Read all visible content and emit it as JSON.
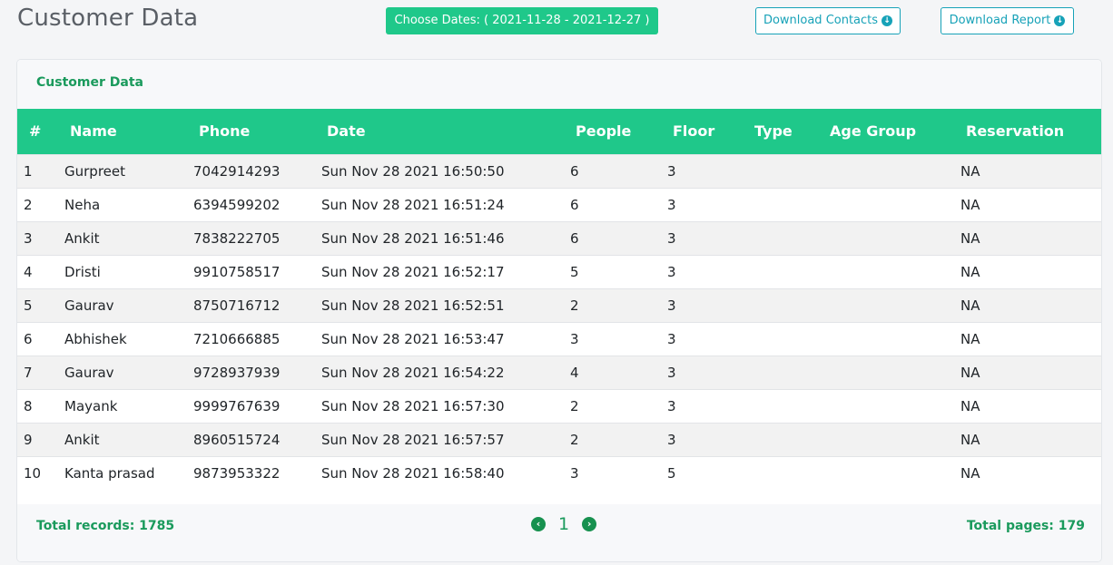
{
  "header": {
    "title": "Customer Data",
    "date_button": "Choose Dates: ( 2021-11-28 - 2021-12-27 )",
    "download_contacts": "Download Contacts",
    "download_report": "Download Report"
  },
  "card": {
    "title": "Customer Data",
    "columns": [
      "#",
      "Name",
      "Phone",
      "Date",
      "People",
      "Floor",
      "Type",
      "Age Group",
      "Reservation"
    ],
    "rows": [
      [
        "1",
        "Gurpreet",
        "7042914293",
        "Sun Nov 28 2021 16:50:50",
        "6",
        "3",
        "",
        "",
        "NA"
      ],
      [
        "2",
        "Neha",
        "6394599202",
        "Sun Nov 28 2021 16:51:24",
        "6",
        "3",
        "",
        "",
        "NA"
      ],
      [
        "3",
        "Ankit",
        "7838222705",
        "Sun Nov 28 2021 16:51:46",
        "6",
        "3",
        "",
        "",
        "NA"
      ],
      [
        "4",
        "Dristi",
        "9910758517",
        "Sun Nov 28 2021 16:52:17",
        "5",
        "3",
        "",
        "",
        "NA"
      ],
      [
        "5",
        "Gaurav",
        "8750716712",
        "Sun Nov 28 2021 16:52:51",
        "2",
        "3",
        "",
        "",
        "NA"
      ],
      [
        "6",
        "Abhishek",
        "7210666885",
        "Sun Nov 28 2021 16:53:47",
        "3",
        "3",
        "",
        "",
        "NA"
      ],
      [
        "7",
        "Gaurav",
        "9728937939",
        "Sun Nov 28 2021 16:54:22",
        "4",
        "3",
        "",
        "",
        "NA"
      ],
      [
        "8",
        "Mayank",
        "9999767639",
        "Sun Nov 28 2021 16:57:30",
        "2",
        "3",
        "",
        "",
        "NA"
      ],
      [
        "9",
        "Ankit",
        "8960515724",
        "Sun Nov 28 2021 16:57:57",
        "2",
        "3",
        "",
        "",
        "NA"
      ],
      [
        "10",
        "Kanta prasad",
        "9873953322",
        "Sun Nov 28 2021 16:58:40",
        "3",
        "5",
        "",
        "",
        "NA"
      ]
    ]
  },
  "footer": {
    "total_records": "Total records: 1785",
    "total_pages": "Total pages: 179",
    "current_page": "1"
  },
  "icons": {
    "download": "arrow-circle-down-icon",
    "prev": "chevron-circle-left-icon",
    "next": "chevron-circle-right-icon"
  },
  "colors": {
    "accent": "#1fc88a",
    "text_green": "#1a9a5c",
    "outline": "#17a2b8"
  }
}
